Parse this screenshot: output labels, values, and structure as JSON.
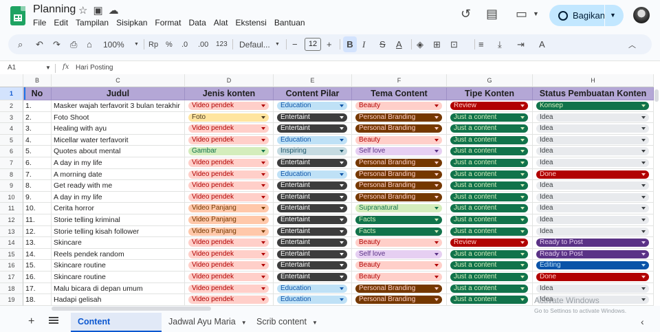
{
  "titlebar": {
    "doc_title": "Planning",
    "share_label": "Bagikan"
  },
  "menu": [
    "File",
    "Edit",
    "Tampilan",
    "Sisipkan",
    "Format",
    "Data",
    "Alat",
    "Ekstensi",
    "Bantuan"
  ],
  "toolbar": {
    "zoom": "100%",
    "currency": "Rp",
    "percent": "%",
    "dec_less": ".0",
    "dec_more": ".00",
    "number_format": "123",
    "font": "Defaul...",
    "font_size": "12",
    "minus": "−",
    "plus": "+",
    "bold": "B",
    "italic": "I",
    "strike": "S",
    "text_color": "A"
  },
  "formula_bar": {
    "cell_ref": "A1",
    "fx": "fx",
    "value": "Hari Posting"
  },
  "columns": [
    "B",
    "C",
    "D",
    "E",
    "F",
    "G",
    "H"
  ],
  "headers": [
    "No",
    "Judul",
    "Jenis konten",
    "Content Pilar",
    "Tema Content",
    "Tipe Konten",
    "Status Pembuatan Konten"
  ],
  "row_numbers": [
    "1",
    "2",
    "3",
    "4",
    "5",
    "6",
    "7",
    "8",
    "9",
    "10",
    "11",
    "12",
    "13",
    "14",
    "15",
    "16",
    "17",
    "18",
    "19"
  ],
  "colors": {
    "header_bg": "#b4a7d6",
    "Video pendek": [
      "#ffcfc9",
      "#b10202"
    ],
    "Foto": [
      "#ffe5a0",
      "#473821"
    ],
    "Gambar": [
      "#d4edbc",
      "#11734b"
    ],
    "Video Panjang": [
      "#ffc8aa",
      "#753800"
    ],
    "Education": [
      "#bfe1f6",
      "#0a53a8"
    ],
    "Entertaint": [
      "#3d3d3d",
      "#ffffff"
    ],
    "Inspiring": [
      "#c6dbe1",
      "#215a6c"
    ],
    "Beauty": [
      "#ffcfc9",
      "#b10202"
    ],
    "Personal Branding": [
      "#753800",
      "#ffcfc9"
    ],
    "Self love": [
      "#e6cff2",
      "#5a3286"
    ],
    "Supranatural": [
      "#d4edbc",
      "#11734b"
    ],
    "Facts": [
      "#11734b",
      "#d4edbc"
    ],
    "Review": [
      "#b10202",
      "#ffcfc9"
    ],
    "Just a content": [
      "#11734b",
      "#d4edbc"
    ],
    "Konsep": [
      "#11734b",
      "#d4edbc"
    ],
    "Idea": [
      "#e8eaed",
      "#3c4043"
    ],
    "Done": [
      "#b10202",
      "#ffcfc9"
    ],
    "Ready to Post": [
      "#5a3286",
      "#e6cff2"
    ],
    "Editing": [
      "#0a53a8",
      "#bfe1f6"
    ]
  },
  "rows": [
    [
      "1.",
      "Masker wajah terfavorit 3 bulan terakhir",
      "Video pendek",
      "Education",
      "Beauty",
      "Review",
      "Konsep"
    ],
    [
      "2.",
      "Foto Shoot",
      "Foto",
      "Entertaint",
      "Personal Branding",
      "Just a content",
      "Idea"
    ],
    [
      "3.",
      "Healing with ayu",
      "Video pendek",
      "Entertaint",
      "Personal Branding",
      "Just a content",
      "Idea"
    ],
    [
      "4.",
      "Micellar water terfavorit",
      "Video pendek",
      "Education",
      "Beauty",
      "Just a content",
      "Idea"
    ],
    [
      "5.",
      "Quotes about mental",
      "Gambar",
      "Inspiring",
      "Self love",
      "Just a content",
      "Idea"
    ],
    [
      "6.",
      "A day in my life",
      "Video pendek",
      "Entertaint",
      "Personal Branding",
      "Just a content",
      "Idea"
    ],
    [
      "7.",
      "A morning date",
      "Video pendek",
      "Education",
      "Personal Branding",
      "Just a content",
      "Done"
    ],
    [
      "8.",
      "Get ready with me",
      "Video pendek",
      "Entertaint",
      "Personal Branding",
      "Just a content",
      "Idea"
    ],
    [
      "9.",
      "A day in my life",
      "Video pendek",
      "Entertaint",
      "Personal Branding",
      "Just a content",
      "Idea"
    ],
    [
      "10.",
      "Cerita horror",
      "Video Panjang",
      "Entertaint",
      "Supranatural",
      "Just a content",
      "Idea"
    ],
    [
      "11.",
      "Storie telling kriminal",
      "Video Panjang",
      "Entertaint",
      "Facts",
      "Just a content",
      "Idea"
    ],
    [
      "12.",
      "Storie telling kisah follower",
      "Video Panjang",
      "Entertaint",
      "Facts",
      "Just a content",
      "Idea"
    ],
    [
      "13.",
      "Skincare",
      "Video pendek",
      "Entertaint",
      "Beauty",
      "Review",
      "Ready to Post"
    ],
    [
      "14.",
      "Reels pendek random",
      "Video pendek",
      "Entertaint",
      "Self love",
      "Just a content",
      "Ready to Post"
    ],
    [
      "15.",
      "Skincare routine",
      "Video pendek",
      "Entertaint",
      "Beauty",
      "Just a content",
      "Editing"
    ],
    [
      "16.",
      "Skincare routine",
      "Video pendek",
      "Entertaint",
      "Beauty",
      "Just a content",
      "Done"
    ],
    [
      "17.",
      "Malu bicara di depan umum",
      "Video pendek",
      "Education",
      "Personal Branding",
      "Just a content",
      "Idea"
    ],
    [
      "18.",
      "Hadapi gelisah",
      "Video pendek",
      "Education",
      "Personal Branding",
      "Just a content",
      "Idea"
    ]
  ],
  "sheet_tabs": [
    "Content Shecdule",
    "Jadwal Ayu Maria",
    "Scrib content"
  ],
  "watermark": {
    "line1": "Activate Windows",
    "line2": "Go to Settings to activate Windows."
  }
}
